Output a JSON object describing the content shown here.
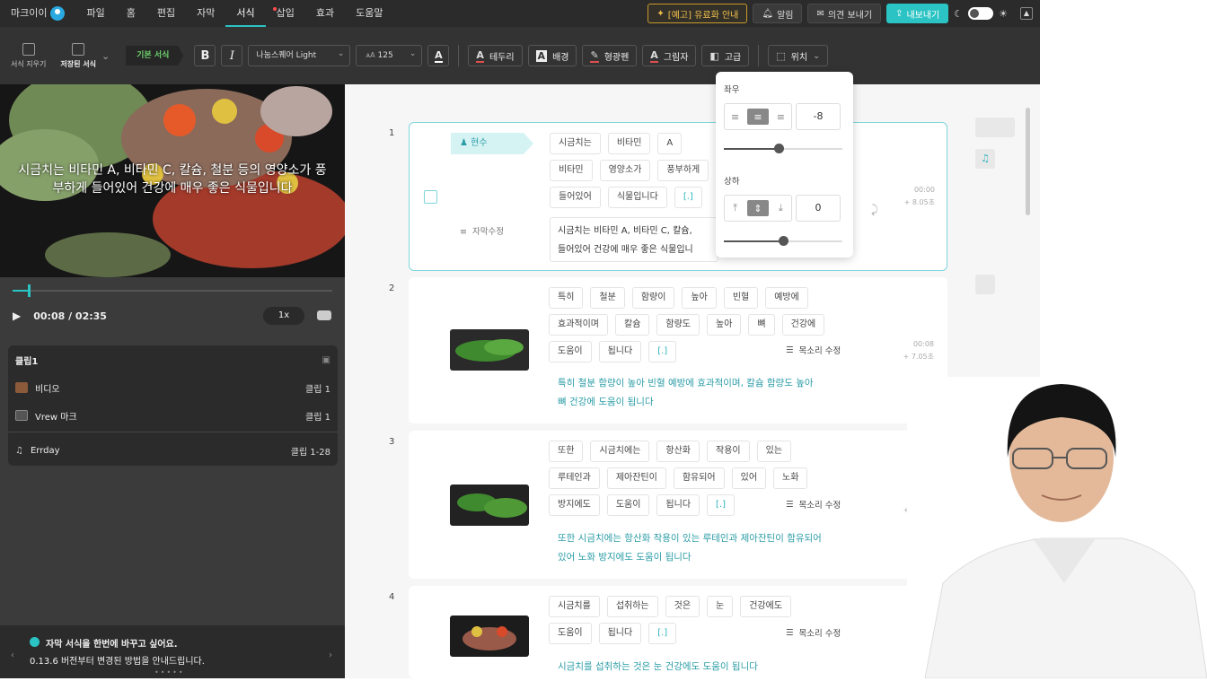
{
  "menubar": {
    "brand": "마크이이",
    "items": [
      "파일",
      "홈",
      "편집",
      "자막",
      "서식",
      "삽입",
      "효과",
      "도움말"
    ],
    "active": "서식",
    "promo": "[예고] 유료화 안내",
    "notify": "알림",
    "feedback": "의견 보내기",
    "export": "내보내기"
  },
  "toolbar": {
    "clear": "서식 지우기",
    "saved": "저장된 서식",
    "basic": "기본 서식",
    "bold": "B",
    "italic": "I",
    "font": "나눔스퀘어 Light",
    "size": "125",
    "outline": "테두리",
    "bg": "배경",
    "highlight": "형광펜",
    "shadow": "그림자",
    "advanced": "고급",
    "position": "위치"
  },
  "video": {
    "caption_line1": "시금치는 비타민 A, 비타민 C, 칼슘, 철분 등의 영양소가 풍",
    "caption_line2": "부하게 들어있어 건강에 매우 좋은 식물입니다",
    "time": "00:08 / 02:35",
    "speed": "1x",
    "progress": 0.05
  },
  "clips": {
    "title": "클립1",
    "rows": [
      {
        "label": "비디오",
        "value": "클립 1"
      },
      {
        "label": "Vrew 마크",
        "value": "클립 1"
      },
      {
        "label": "Errday",
        "value": "클립 1-28"
      }
    ]
  },
  "tip": {
    "line1": "자막 서식을 한번에 바꾸고 싶어요.",
    "line2": "0.13.6 버전부터 변경된 방법을 안내드립니다."
  },
  "popup": {
    "h_label": "좌우",
    "h_value": "-8",
    "v_label": "상하",
    "v_value": "0",
    "h_level": 0.46,
    "v_level": 0.5
  },
  "cards": [
    {
      "num": "1",
      "speaker": "현수",
      "words": [
        "시금치는",
        "비타민",
        "A",
        "비타민",
        "영양소가",
        "풍부하게",
        "들어있어",
        "식물입니다",
        "[.]"
      ],
      "edit_label": "자막수정",
      "sent": "시금치는 비타민 A, 비타민 C, 칼슘,",
      "sent2": "들어있어 건강에 매우 좋은 식물입니",
      "time": "00:00",
      "dur": "+ 8.05초"
    },
    {
      "num": "2",
      "words": [
        "특히",
        "철분",
        "함량이",
        "높아",
        "빈혈",
        "예방에",
        "효과적이며",
        "칼슘",
        "함량도",
        "높아",
        "뼈",
        "건강에",
        "도움이",
        "됩니다",
        "[.]"
      ],
      "voice": "목소리 수정",
      "sent": "특히 철분 함량이 높아 빈혈 예방에 효과적이며, 칼슘 함량도 높아",
      "sent2": "뼈 건강에 도움이 됩니다",
      "time": "00:08",
      "dur": "+ 7.05초"
    },
    {
      "num": "3",
      "words": [
        "또한",
        "시금치에는",
        "항산화",
        "작용이",
        "있는",
        "루테인과",
        "제아잔틴이",
        "함유되어",
        "있어",
        "노화",
        "방지에도",
        "도움이",
        "됩니다",
        "[.]"
      ],
      "voice": "목소리 수정",
      "sent": "또한 시금치에는 항산화 작용이 있는 루테인과 제아잔틴이 함유되어",
      "sent2": "있어 노화 방지에도 도움이 됩니다",
      "time": "00:15",
      "dur": "+ 6.95초"
    },
    {
      "num": "4",
      "words": [
        "시금치를",
        "섭취하는",
        "것은",
        "눈",
        "건강에도",
        "도움이",
        "됩니다",
        "[.]"
      ],
      "voice": "목소리 수정",
      "sent": "시금치를 섭취하는 것은 눈 건강에도 도움이 됩니다"
    }
  ]
}
